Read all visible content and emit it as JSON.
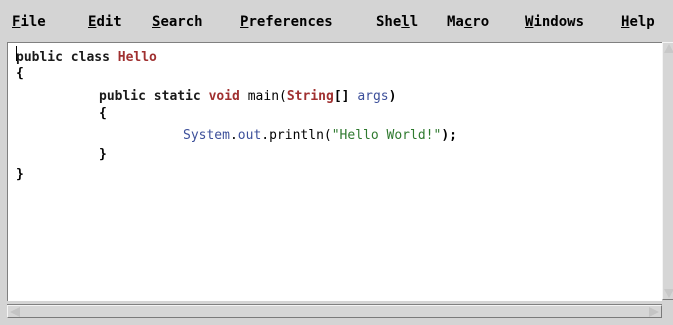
{
  "menubar": {
    "items": [
      {
        "before": "",
        "mnemonic": "F",
        "after": "ile"
      },
      {
        "before": "",
        "mnemonic": "E",
        "after": "dit"
      },
      {
        "before": "",
        "mnemonic": "S",
        "after": "earch"
      },
      {
        "before": "",
        "mnemonic": "P",
        "after": "references"
      },
      {
        "before": "She",
        "mnemonic": "l",
        "after": "l"
      },
      {
        "before": "Ma",
        "mnemonic": "c",
        "after": "ro"
      },
      {
        "before": "",
        "mnemonic": "W",
        "after": "indows"
      },
      {
        "before": "",
        "mnemonic": "H",
        "after": "elp"
      }
    ]
  },
  "editor": {
    "line1": {
      "kw": "public class ",
      "name": "Hello"
    },
    "line2": {
      "brace": "{"
    },
    "line3": {
      "kw": "public static ",
      "type": "void",
      "method": " main(",
      "argtype": "String",
      "rest": "[] ",
      "arg": "args",
      "close": ")"
    },
    "line4": {
      "brace": "{"
    },
    "line5": {
      "obj": "System",
      "dot1": ".",
      "field": "out",
      "call": ".println(",
      "str": "\"Hello World!\"",
      "end": ");"
    },
    "line6": {
      "brace": "}"
    },
    "line7": {
      "brace": "}"
    }
  }
}
